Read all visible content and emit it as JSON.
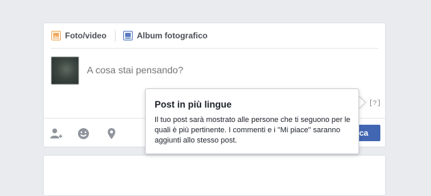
{
  "composer": {
    "tabs": [
      {
        "label": "Foto/video",
        "icon": "photo-video-icon"
      },
      {
        "label": "Album fotografico",
        "icon": "photo-album-icon"
      }
    ],
    "status_placeholder": "A cosa stai pensando?",
    "help_link": "[?]",
    "actions": [
      {
        "icon": "tag-friends-icon"
      },
      {
        "icon": "feeling-smiley-icon"
      },
      {
        "icon": "location-pin-icon"
      }
    ],
    "post_button_visible_label": "ca"
  },
  "tooltip": {
    "title": "Post in più lingue",
    "body": "Il tuo post sarà mostrato alle persone che ti seguono per le quali è più pertinente. I commenti e i \"Mi piace\" saranno aggiunti allo stesso post."
  },
  "colors": {
    "background": "#e9ebee",
    "brand_blue": "#4267b2",
    "photo_icon_orange": "#f0a95b",
    "album_icon_blue": "#5b7bc0",
    "action_icon_gray": "#90949c"
  }
}
